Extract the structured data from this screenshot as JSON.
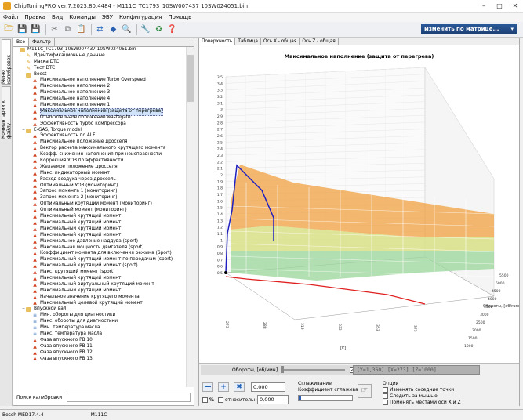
{
  "window": {
    "title": "ChipTuningPRO ver.7.2023.80.4484 - M111C_TC1793_10SW007437 10SW024051.bin"
  },
  "menu": [
    "Файл",
    "Правка",
    "Вид",
    "Команды",
    "ЭБУ",
    "Конфигурация",
    "Помощь"
  ],
  "toolbar": {
    "change_matrix_label": "Изменить по матрице..."
  },
  "side_tabs": [
    "Меню калибровок",
    "Комментарии к файлу"
  ],
  "left_tabs": [
    "Все",
    "Фильтр"
  ],
  "tree": [
    {
      "level": 0,
      "type": "folder",
      "label": "M111C_TC1793_10SW007437 10SW024051.bin",
      "expanded": true
    },
    {
      "level": 1,
      "type": "item",
      "label": "Идентификационные данные"
    },
    {
      "level": 1,
      "type": "item",
      "label": "Маска DTC"
    },
    {
      "level": 1,
      "type": "item",
      "label": "Тест DTC"
    },
    {
      "level": 1,
      "type": "folder",
      "label": "Boost",
      "expanded": true
    },
    {
      "level": 2,
      "type": "map",
      "label": "Максимальное наполнение Turbo Overspeed"
    },
    {
      "level": 2,
      "type": "map",
      "label": "Максимальное наполнение 2"
    },
    {
      "level": 2,
      "type": "map",
      "label": "Максимальное наполнение 3"
    },
    {
      "level": 2,
      "type": "map",
      "label": "Максимальное наполнение 4"
    },
    {
      "level": 2,
      "type": "map",
      "label": "Максимальное наполнение 1"
    },
    {
      "level": 2,
      "type": "map",
      "label": "Максимальное наполнение (защита от перегрева)",
      "selected": true
    },
    {
      "level": 2,
      "type": "map",
      "label": "Относительное положение wastegate"
    },
    {
      "level": 2,
      "type": "map",
      "label": "Эффективность турбо компрессора"
    },
    {
      "level": 1,
      "type": "folder",
      "label": "E-GAS, Torque model",
      "expanded": true
    },
    {
      "level": 2,
      "type": "map",
      "label": "Эффективность по ALF"
    },
    {
      "level": 2,
      "type": "map",
      "label": "Максимальное положение дросселя"
    },
    {
      "level": 2,
      "type": "map",
      "label": "Вектор расчета максимального крутящего момента"
    },
    {
      "level": 2,
      "type": "map",
      "label": "Коэфф. снижения наполнения при неисправности"
    },
    {
      "level": 2,
      "type": "map",
      "label": "Коррекция УОЗ по эффективности"
    },
    {
      "level": 2,
      "type": "map",
      "label": "Желаемое положение дросселя"
    },
    {
      "level": 2,
      "type": "map",
      "label": "Макс. индикаторный момент"
    },
    {
      "level": 2,
      "type": "map",
      "label": "Расход воздуха через дроссель"
    },
    {
      "level": 2,
      "type": "map",
      "label": "Оптимальный УОЗ (мониторинг)"
    },
    {
      "level": 2,
      "type": "map",
      "label": "Запрос момента 1 (мониторинг)"
    },
    {
      "level": 2,
      "type": "map",
      "label": "Запрос момента 2 (мониторинг)"
    },
    {
      "level": 2,
      "type": "map",
      "label": "Оптимальный крутящий момент (мониторинг)"
    },
    {
      "level": 2,
      "type": "map",
      "label": "Оптимальный момент (мониторинг)"
    },
    {
      "level": 2,
      "type": "map",
      "label": "Максимальный крутящий момент"
    },
    {
      "level": 2,
      "type": "map",
      "label": "Максимальный крутящий момент"
    },
    {
      "level": 2,
      "type": "map",
      "label": "Максимальный крутящий момент"
    },
    {
      "level": 2,
      "type": "map",
      "label": "Максимальный крутящий момент"
    },
    {
      "level": 2,
      "type": "map",
      "label": "Максимальное давление наддува (sport)"
    },
    {
      "level": 2,
      "type": "map",
      "label": "Максимальная мощность двигателя (sport)"
    },
    {
      "level": 2,
      "type": "map",
      "label": "Коэффициент момента для включения режима (Sport)"
    },
    {
      "level": 2,
      "type": "map",
      "label": "Максимальный крутящий момент по передачам (sport)"
    },
    {
      "level": 2,
      "type": "map",
      "label": "Максимальный крутящий момент (sport)"
    },
    {
      "level": 2,
      "type": "map",
      "label": "Макс. крутящий момент (sport)"
    },
    {
      "level": 2,
      "type": "map",
      "label": "Максимальный крутящий момент"
    },
    {
      "level": 2,
      "type": "map",
      "label": "Максимальный виртуальный крутящий момент"
    },
    {
      "level": 2,
      "type": "map",
      "label": "Максимальный крутящий момент"
    },
    {
      "level": 2,
      "type": "map",
      "label": "Начальное значение крутящего момента"
    },
    {
      "level": 2,
      "type": "map",
      "label": "Максимальный целевой крутящий момент"
    },
    {
      "level": 1,
      "type": "folder",
      "label": "Впускной вал",
      "expanded": true
    },
    {
      "level": 2,
      "type": "axis",
      "label": "Мин. обороты для диагностики"
    },
    {
      "level": 2,
      "type": "axis",
      "label": "Макс. обороты для диагностики"
    },
    {
      "level": 2,
      "type": "axis",
      "label": "Мин. температура масла"
    },
    {
      "level": 2,
      "type": "axis",
      "label": "Макс. температура масла"
    },
    {
      "level": 2,
      "type": "map",
      "label": "Фаза впускного РВ 10"
    },
    {
      "level": 2,
      "type": "map",
      "label": "Фаза впускного РВ 11"
    },
    {
      "level": 2,
      "type": "map",
      "label": "Фаза впускного РВ 12"
    },
    {
      "level": 2,
      "type": "map",
      "label": "Фаза впускного РВ 13"
    }
  ],
  "search": {
    "label": "Поиск калибровки"
  },
  "view_tabs": [
    "Поверхность",
    "Таблица",
    "Ось X - общая",
    "Ось Z - общая"
  ],
  "chart": {
    "title": "Максимальное наполнение (защита от перегрева)",
    "y_ticks": [
      "0.5",
      "0.6",
      "0.7",
      "0.8",
      "0.9",
      "1",
      "1.1",
      "1.2",
      "1.3",
      "1.4",
      "1.5",
      "1.6",
      "1.7",
      "1.8",
      "1.9",
      "2",
      "2.1",
      "2.2",
      "2.3",
      "2.4",
      "2.5",
      "2.6",
      "2.7",
      "2.8",
      "2.9",
      "3",
      "3.1",
      "3.2",
      "3.3",
      "3.4",
      "3.5"
    ],
    "x_ticks": [
      "273",
      "288",
      "313",
      "333",
      "353",
      "373"
    ],
    "z_ticks": [
      "1000",
      "1500",
      "2000",
      "2500",
      "3000",
      "3500",
      "4000",
      "4500",
      "5000",
      "5500"
    ],
    "x_label": "[K]",
    "z_label": "Обороты, [об/мин]",
    "colors": {
      "surface_high": "#f0a040",
      "surface_mid": "#d8e080",
      "surface_low": "#a0d8a0",
      "blue_line": "#2020c0",
      "red_line": "#e02020"
    }
  },
  "bottom": {
    "slider_label": "Обороты, [об/мин]",
    "check_3d": "3D",
    "coord_text": "[Y=1,360] [X=273] [Z=1000]",
    "value1": "0,000",
    "value2": "0,000",
    "pct_label": "%",
    "relative_label": "относительно",
    "smoothing_title": "Сглаживание",
    "smoothing_coef_label": "Коэффициент сглаживания",
    "options_title": "Опции",
    "options": [
      "Изменять соседние точки",
      "Следить за мышью",
      "Поменять местами оси X и Z"
    ]
  },
  "status": {
    "ecu": "Bosch MED17.4.4",
    "model": "M111C"
  }
}
